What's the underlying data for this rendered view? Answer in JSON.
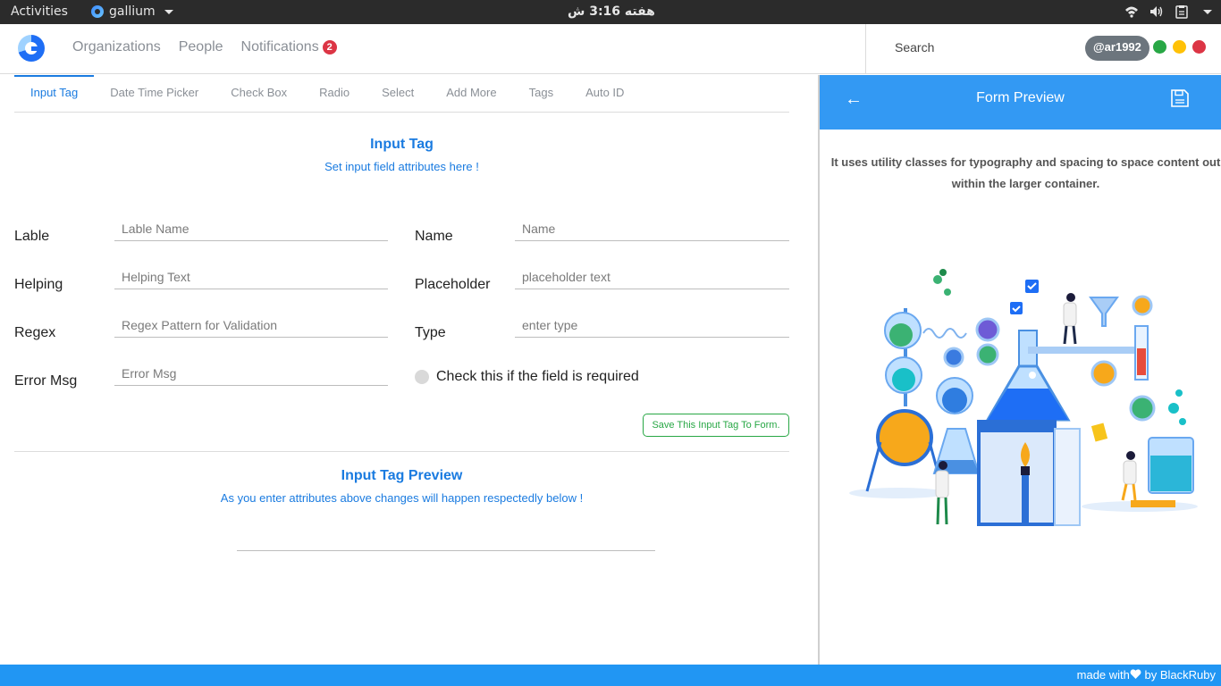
{
  "system_bar": {
    "activities": "Activities",
    "app_name": "gallium",
    "clock": "هفته 3:16 ش"
  },
  "header": {
    "nav": {
      "organizations": "Organizations",
      "people": "People",
      "notifications": "Notifications",
      "notifications_count": "2"
    },
    "search_label": "Search",
    "username": "@ar1992",
    "window_dots": [
      "#28a745",
      "#ffc107",
      "#dc3545"
    ]
  },
  "tabs": [
    "Input Tag",
    "Date Time Picker",
    "Check Box",
    "Radio",
    "Select",
    "Add More",
    "Tags",
    "Auto ID"
  ],
  "form": {
    "title": "Input Tag",
    "subtitle": "Set input field attributes here !",
    "fields": {
      "label": {
        "label": "Lable",
        "placeholder": "Lable Name"
      },
      "name": {
        "label": "Name",
        "placeholder": "Name"
      },
      "helping": {
        "label": "Helping",
        "placeholder": "Helping Text"
      },
      "placeholder": {
        "label": "Placeholder",
        "placeholder": "placeholder text"
      },
      "regex": {
        "label": "Regex",
        "placeholder": "Regex Pattern for Validation"
      },
      "type": {
        "label": "Type",
        "placeholder": "enter type"
      },
      "error": {
        "label": "Error Msg",
        "placeholder": "Error Msg"
      }
    },
    "required_check": "Check this if the field is required",
    "save_button": "Save This Input Tag To Form."
  },
  "tag_preview": {
    "title": "Input Tag Preview",
    "subtitle": "As you enter attributes above changes will happen respectedly below !"
  },
  "form_preview": {
    "title": "Form Preview",
    "description": "It uses utility classes for typography and spacing to space content out within the larger container."
  },
  "footer": {
    "made_with": "made with",
    "by": "by BlackRuby"
  },
  "colors": {
    "accent": "#1a7be0",
    "panel_header": "#3399f3",
    "footer": "#2196f3",
    "success": "#28a745",
    "danger": "#dc3545"
  }
}
